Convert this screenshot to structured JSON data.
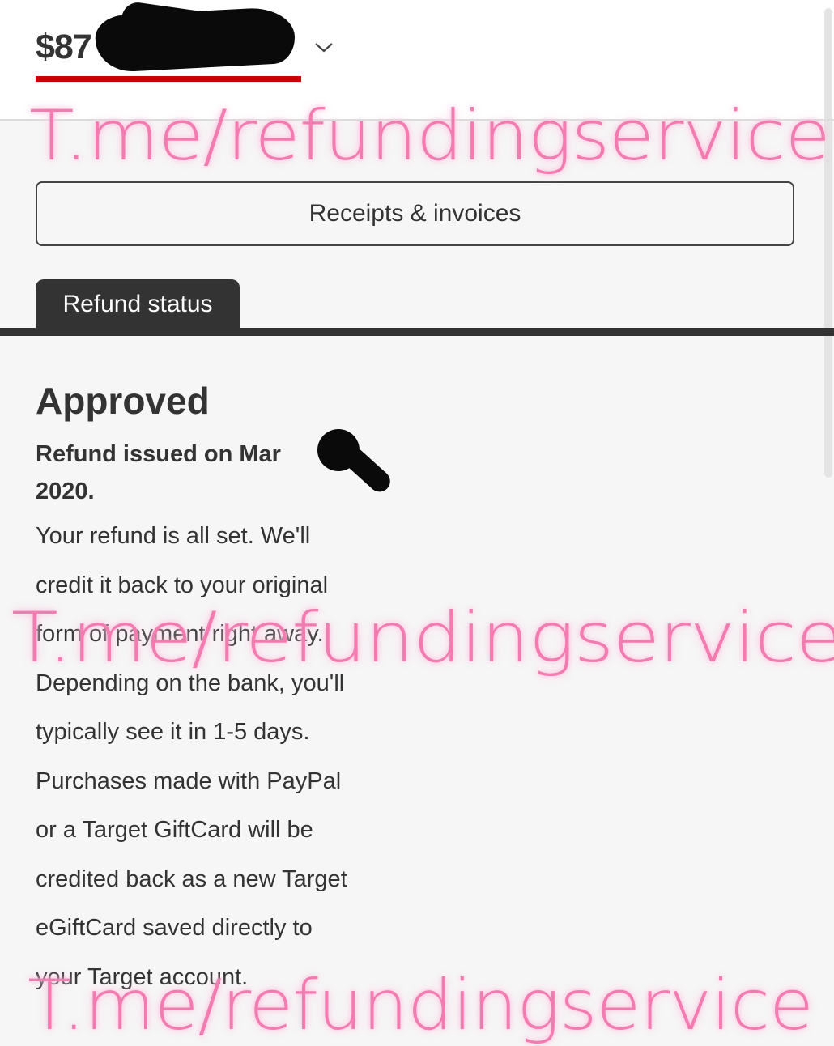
{
  "header": {
    "amount_visible": "$87",
    "dropdown_icon": "chevron-down-icon"
  },
  "receipts_button": {
    "label": "Receipts & invoices"
  },
  "tabs": [
    {
      "label": "Refund status",
      "active": true
    }
  ],
  "status": {
    "title": "Approved",
    "issued_line1": "Refund issued on Mar",
    "issued_line2": "2020.",
    "body_lines": [
      "Your refund is all set. We'll",
      "credit it back to your original",
      "form of payment right away.",
      "Depending on the bank, you'll",
      "typically see it in 1-5 days.",
      "Purchases made with PayPal",
      "or a Target GiftCard will be",
      "credited back as a new Target",
      "eGiftCard saved directly to",
      "your Target account."
    ]
  },
  "watermark": {
    "text": "T.me/refundingservice"
  },
  "colors": {
    "accent_red": "#cc0000",
    "tab_dark": "#333333",
    "watermark_pink": "#f27bb0"
  }
}
